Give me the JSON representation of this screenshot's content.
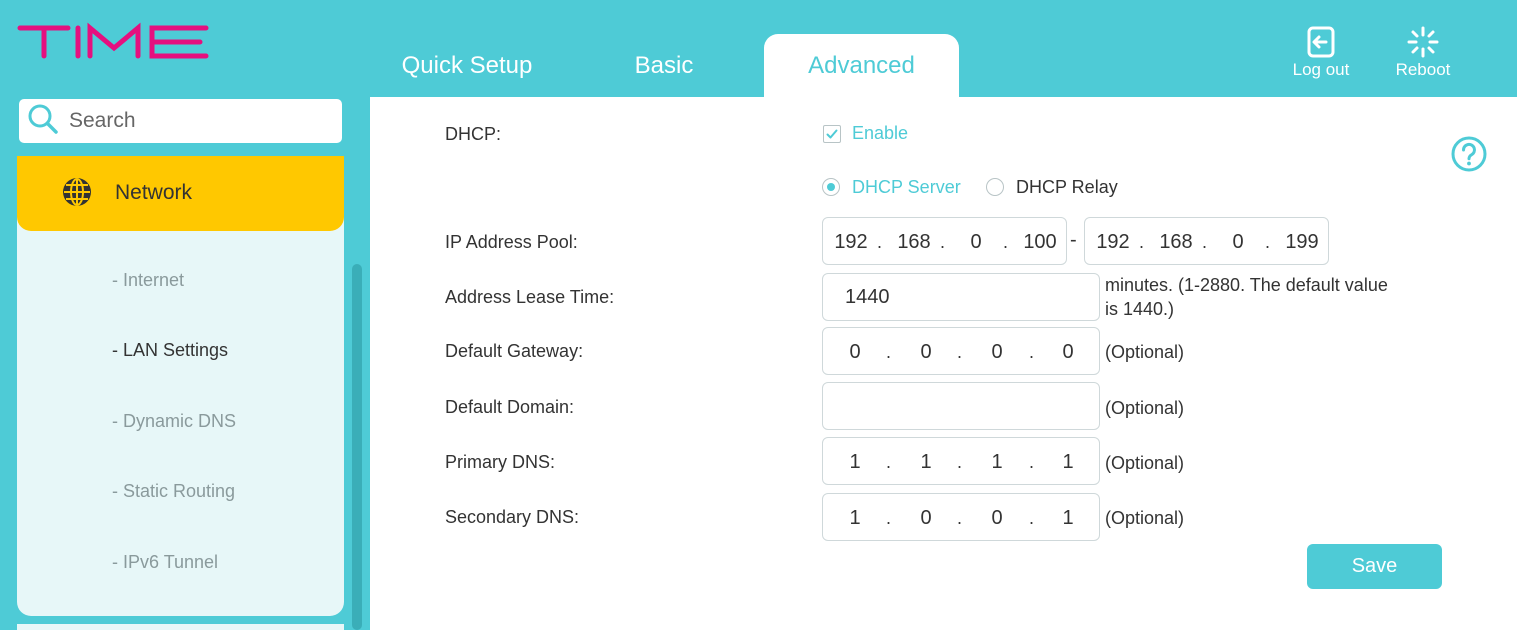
{
  "brand": {
    "logo_text": "TIME",
    "accent": "#4ecbd6",
    "logo_color": "#e5107f",
    "highlight": "#ffc800"
  },
  "tabs": [
    {
      "label": "Quick Setup",
      "active": false
    },
    {
      "label": "Basic",
      "active": false
    },
    {
      "label": "Advanced",
      "active": true
    }
  ],
  "header_actions": {
    "logout_label": "Log out",
    "reboot_label": "Reboot"
  },
  "sidebar": {
    "search_placeholder": "Search",
    "section": {
      "label": "Network",
      "icon": "globe-icon"
    },
    "items": [
      {
        "label": "- Internet",
        "active": false
      },
      {
        "label": "- LAN Settings",
        "active": true
      },
      {
        "label": "- Dynamic DNS",
        "active": false
      },
      {
        "label": "- Static Routing",
        "active": false
      },
      {
        "label": "- IPv6 Tunnel",
        "active": false
      }
    ]
  },
  "form": {
    "dhcp_label": "DHCP:",
    "enable_label": "Enable",
    "enable_checked": true,
    "mode_options": [
      "DHCP Server",
      "DHCP Relay"
    ],
    "mode_selected": "DHCP Server",
    "ip_pool_label": "IP Address Pool:",
    "ip_pool_start": [
      "192",
      "168",
      "0",
      "100"
    ],
    "ip_pool_end": [
      "192",
      "168",
      "0",
      "199"
    ],
    "ip_pool_separator": "-",
    "lease_label": "Address Lease Time:",
    "lease_value": "1440",
    "lease_hint_line1": "minutes. (1-2880. The default value",
    "lease_hint_line2": "is 1440.)",
    "gateway_label": "Default Gateway:",
    "gateway_value": [
      "0",
      "0",
      "0",
      "0"
    ],
    "domain_label": "Default Domain:",
    "domain_value": "",
    "primary_dns_label": "Primary DNS:",
    "primary_dns_value": [
      "1",
      "1",
      "1",
      "1"
    ],
    "secondary_dns_label": "Secondary DNS:",
    "secondary_dns_value": [
      "1",
      "0",
      "0",
      "1"
    ],
    "optional_hint": "(Optional)",
    "save_label": "Save"
  }
}
